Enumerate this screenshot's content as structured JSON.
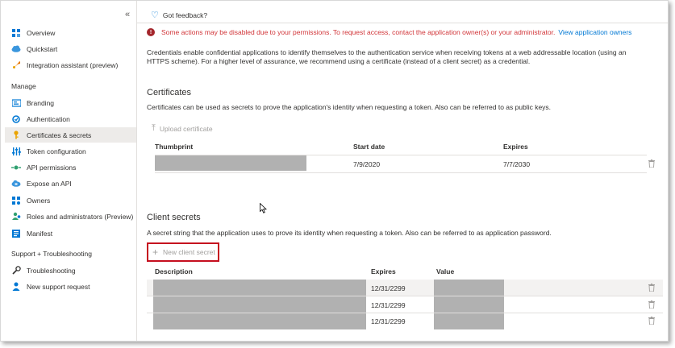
{
  "sidebar": {
    "collapse_glyph": "«",
    "items_top": [
      {
        "label": "Overview",
        "icon": "grid-icon"
      },
      {
        "label": "Quickstart",
        "icon": "cloud-icon"
      },
      {
        "label": "Integration assistant (preview)",
        "icon": "rocket-icon"
      }
    ],
    "manage_heading": "Manage",
    "items_manage": [
      {
        "label": "Branding",
        "icon": "branding-icon"
      },
      {
        "label": "Authentication",
        "icon": "auth-icon"
      },
      {
        "label": "Certificates & secrets",
        "icon": "key-icon",
        "active": true
      },
      {
        "label": "Token configuration",
        "icon": "token-icon"
      },
      {
        "label": "API permissions",
        "icon": "api-permissions-icon"
      },
      {
        "label": "Expose an API",
        "icon": "cloud-api-icon"
      },
      {
        "label": "Owners",
        "icon": "owners-icon"
      },
      {
        "label": "Roles and administrators (Preview)",
        "icon": "roles-icon"
      },
      {
        "label": "Manifest",
        "icon": "manifest-icon"
      }
    ],
    "support_heading": "Support + Troubleshooting",
    "items_support": [
      {
        "label": "Troubleshooting",
        "icon": "wrench-icon"
      },
      {
        "label": "New support request",
        "icon": "support-person-icon"
      }
    ]
  },
  "main": {
    "feedback_label": "Got feedback?",
    "warning": {
      "text": "Some actions may be disabled due to your permissions. To request access, contact the application owner(s) or your administrator.",
      "link": "View application owners"
    },
    "intro": "Credentials enable confidential applications to identify themselves to the authentication service when receiving tokens at a web addressable location (using an HTTPS scheme). For a higher level of assurance, we recommend using a certificate (instead of a client secret) as a credential.",
    "certificates": {
      "heading": "Certificates",
      "description": "Certificates can be used as secrets to prove the application's identity when requesting a token. Also can be referred to as public keys.",
      "upload_label": "Upload certificate",
      "columns": [
        "Thumbprint",
        "Start date",
        "Expires"
      ],
      "rows": [
        {
          "start": "7/9/2020",
          "expires": "7/7/2030"
        }
      ]
    },
    "secrets": {
      "heading": "Client secrets",
      "description": "A secret string that the application uses to prove its identity when requesting a token. Also can be referred to as application password.",
      "new_label": "New client secret",
      "columns": [
        "Description",
        "Expires",
        "Value"
      ],
      "rows": [
        {
          "expires": "12/31/2299"
        },
        {
          "expires": "12/31/2299"
        },
        {
          "expires": "12/31/2299"
        }
      ]
    }
  },
  "colors": {
    "accent": "#0078d4",
    "error": "#d13438",
    "highlight_border": "#c50f1f",
    "redacted": "#b1b1b1"
  }
}
